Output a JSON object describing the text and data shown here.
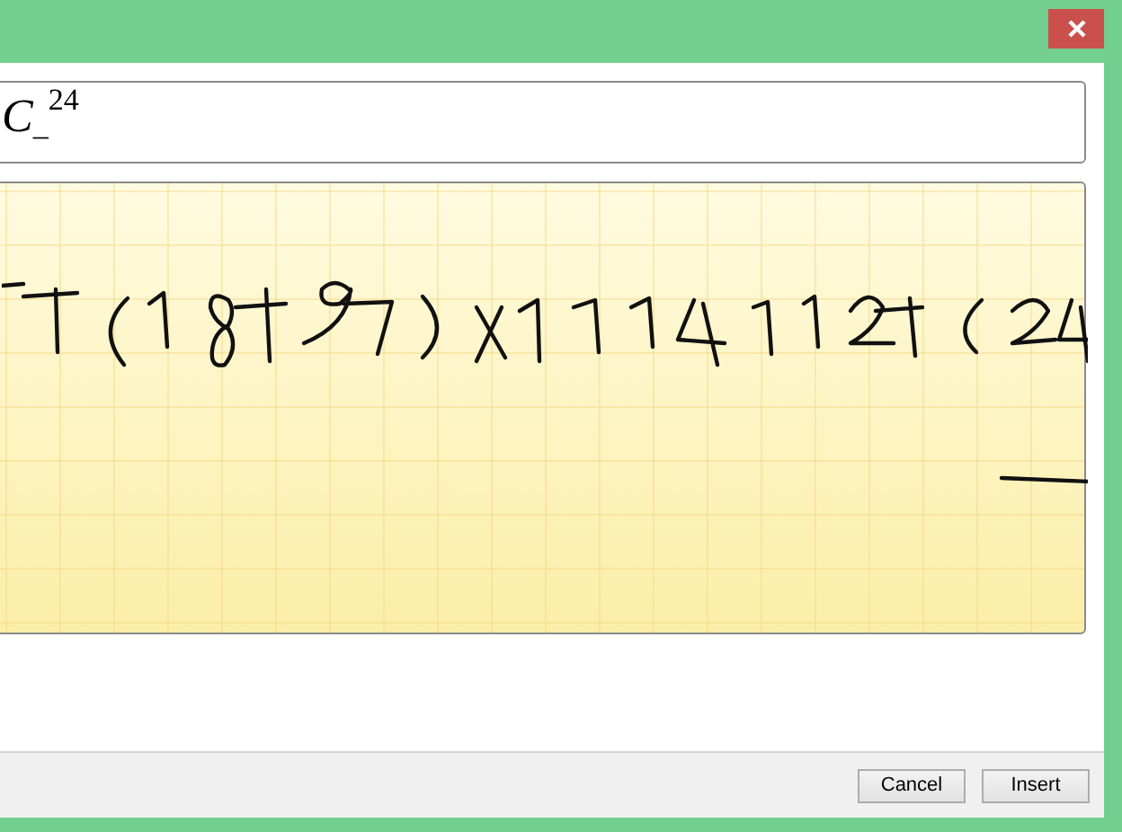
{
  "preview": {
    "base": "C",
    "subscript": "_",
    "superscript": "24"
  },
  "buttons": [
    {
      "label": "Cancel"
    },
    {
      "label": "Insert"
    }
  ]
}
